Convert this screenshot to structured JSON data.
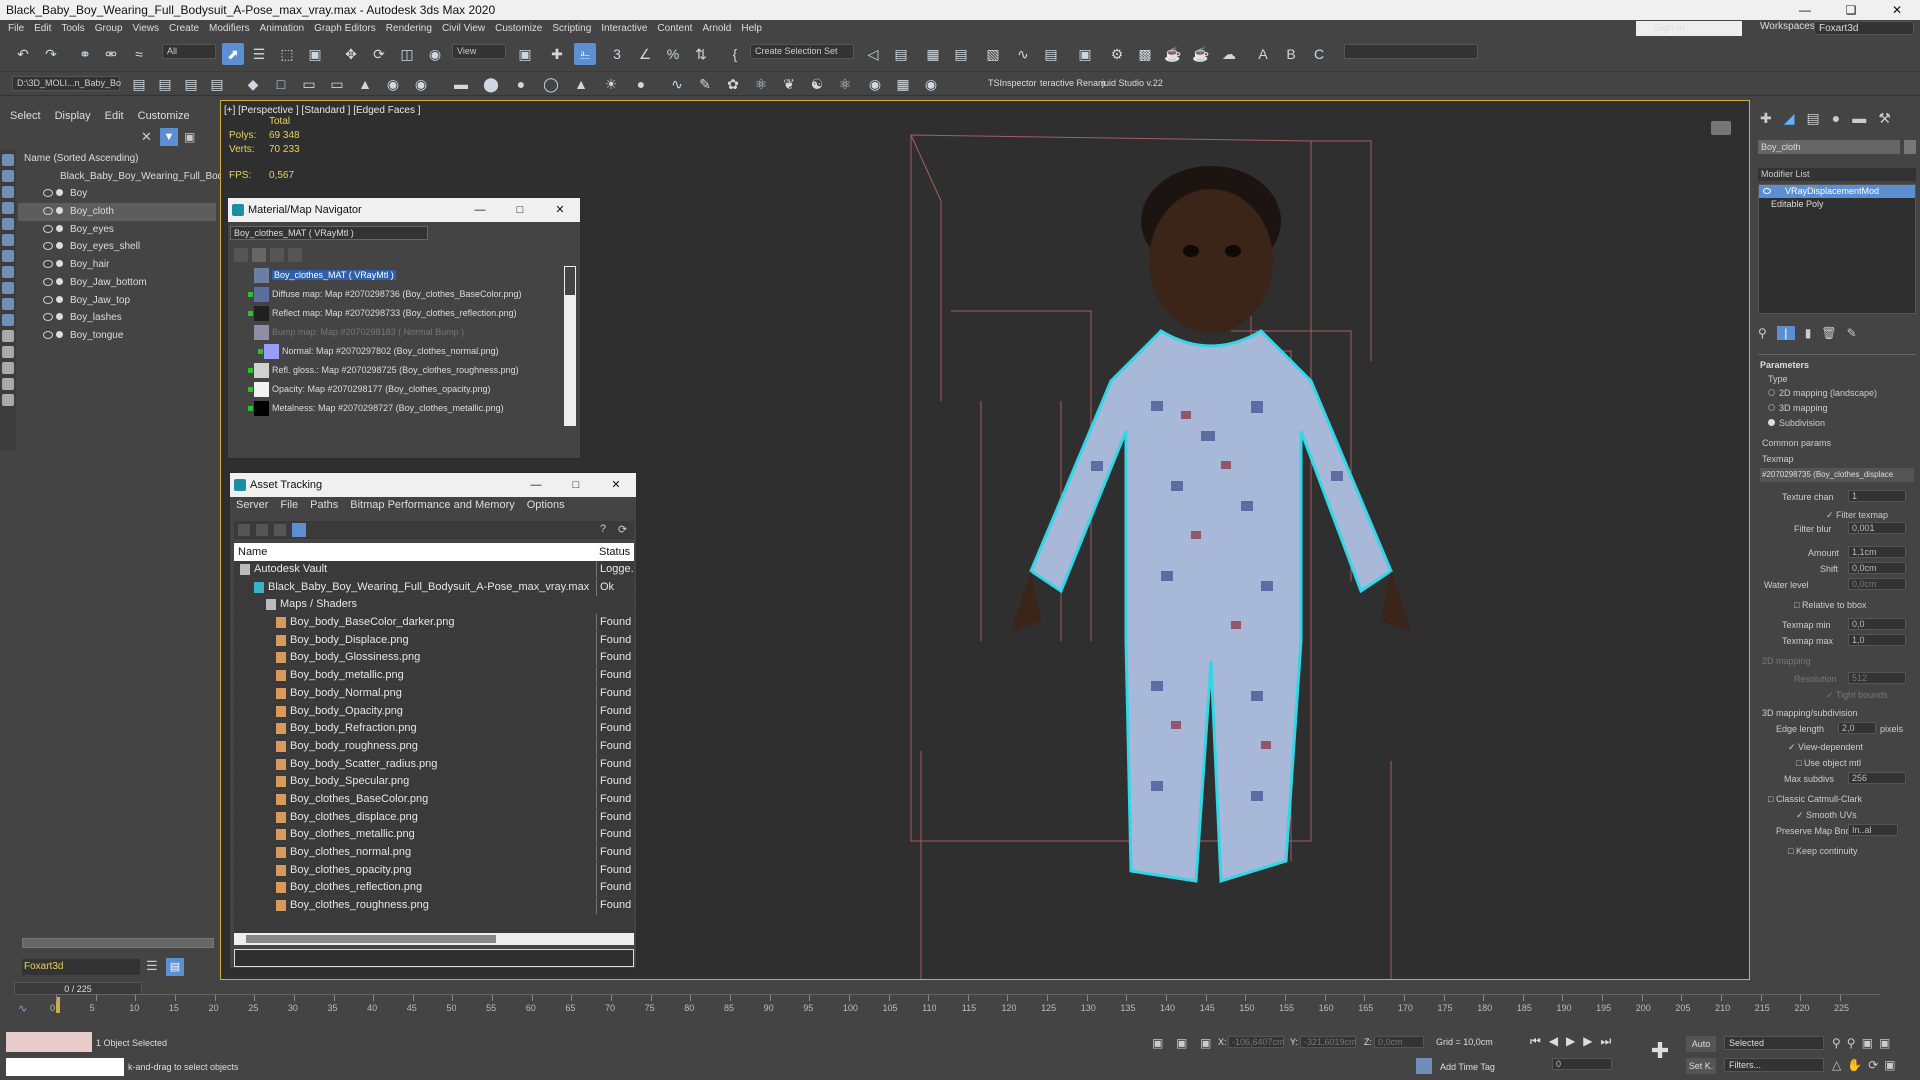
{
  "window": {
    "title": "Black_Baby_Boy_Wearing_Full_Bodysuit_A-Pose_max_vray.max - Autodesk 3ds Max 2020"
  },
  "menu": [
    "File",
    "Edit",
    "Tools",
    "Group",
    "Views",
    "Create",
    "Modifiers",
    "Animation",
    "Graph Editors",
    "Rendering",
    "Civil View",
    "Customize",
    "Scripting",
    "Interactive",
    "Content",
    "Arnold",
    "Help"
  ],
  "account": {
    "sign_in": "Sign In",
    "workspaces_label": "Workspaces:",
    "workspace": "Foxart3d"
  },
  "toolbar": {
    "filter": "All",
    "view": "View",
    "selection_set": "Create Selection Set",
    "path": "D:\\3D_MOLI...n_Baby_Bo",
    "tsinspector": "TSInspector",
    "interactive_rename": "teractive Renam",
    "fluid_studio": "juid Studio v.22"
  },
  "scene_explorer": {
    "tabs": [
      "Select",
      "Display",
      "Edit",
      "Customize"
    ],
    "sort_header": "Name (Sorted Ascending)",
    "root": "Black_Baby_Boy_Wearing_Full_Bodys",
    "items": [
      "Boy",
      "Boy_cloth",
      "Boy_eyes",
      "Boy_eyes_shell",
      "Boy_hair",
      "Boy_Jaw_bottom",
      "Boy_Jaw_top",
      "Boy_lashes",
      "Boy_tongue"
    ],
    "selected": "Boy_cloth",
    "layer": "Foxart3d"
  },
  "viewport": {
    "label": "[+] [Perspective ] [Standard ] [Edged Faces ]",
    "total_label": "Total",
    "polys_label": "Polys:",
    "polys": "69 348",
    "verts_label": "Verts:",
    "verts": "70 233",
    "fps_label": "FPS:",
    "fps": "0,567"
  },
  "material_navigator": {
    "title": "Material/Map Navigator",
    "material": "Boy_clothes_MAT  ( VRayMtl )",
    "root": "Boy_clothes_MAT  ( VRayMtl )",
    "maps": [
      {
        "label": "Diffuse map: Map #2070298736 (Boy_clothes_BaseColor.png)",
        "swatch": "#5a6f9c"
      },
      {
        "label": "Reflect map: Map #2070298733 (Boy_clothes_reflection.png)",
        "swatch": "#202020"
      },
      {
        "label": "Bump map: Map #2070298183  ( Normal Bump )",
        "swatch": "#8e8ea8"
      },
      {
        "label": "Normal: Map #2070297802 (Boy_clothes_normal.png)",
        "swatch": "#9a9cf5"
      },
      {
        "label": "Refl. gloss.: Map #2070298725 (Boy_clothes_roughness.png)",
        "swatch": "#d0d0d0"
      },
      {
        "label": "Opacity: Map #2070298177 (Boy_clothes_opacity.png)",
        "swatch": "#f2f2f2"
      },
      {
        "label": "Metalness: Map #2070298727 (Boy_clothes_metallic.png)",
        "swatch": "#000000"
      }
    ]
  },
  "asset_tracking": {
    "title": "Asset Tracking",
    "menu": [
      "Server",
      "File",
      "Paths",
      "Bitmap Performance and Memory",
      "Options"
    ],
    "columns": {
      "name": "Name",
      "status": "Status"
    },
    "rows": [
      {
        "name": "Autodesk Vault",
        "status": "Logge..."
      },
      {
        "name": "Black_Baby_Boy_Wearing_Full_Bodysuit_A-Pose_max_vray.max",
        "status": "Ok"
      },
      {
        "name": "Maps / Shaders",
        "status": ""
      },
      {
        "name": "Boy_body_BaseColor_darker.png",
        "status": "Found"
      },
      {
        "name": "Boy_body_Displace.png",
        "status": "Found"
      },
      {
        "name": "Boy_body_Glossiness.png",
        "status": "Found"
      },
      {
        "name": "Boy_body_metallic.png",
        "status": "Found"
      },
      {
        "name": "Boy_body_Normal.png",
        "status": "Found"
      },
      {
        "name": "Boy_body_Opacity.png",
        "status": "Found"
      },
      {
        "name": "Boy_body_Refraction.png",
        "status": "Found"
      },
      {
        "name": "Boy_body_roughness.png",
        "status": "Found"
      },
      {
        "name": "Boy_body_Scatter_radius.png",
        "status": "Found"
      },
      {
        "name": "Boy_body_Specular.png",
        "status": "Found"
      },
      {
        "name": "Boy_clothes_BaseColor.png",
        "status": "Found"
      },
      {
        "name": "Boy_clothes_displace.png",
        "status": "Found"
      },
      {
        "name": "Boy_clothes_metallic.png",
        "status": "Found"
      },
      {
        "name": "Boy_clothes_normal.png",
        "status": "Found"
      },
      {
        "name": "Boy_clothes_opacity.png",
        "status": "Found"
      },
      {
        "name": "Boy_clothes_reflection.png",
        "status": "Found"
      },
      {
        "name": "Boy_clothes_roughness.png",
        "status": "Found"
      }
    ]
  },
  "command_panel": {
    "object_name": "Boy_cloth",
    "modifier_list": "Modifier List",
    "stack": [
      "VRayDisplacementMod",
      "Editable Poly"
    ],
    "rollout": "Parameters",
    "type_label": "Type",
    "types": [
      "2D mapping (landscape)",
      "3D mapping",
      "Subdivision"
    ],
    "common_params": "Common params",
    "texmap_label": "Texmap",
    "texmap": "#2070298735 (Boy_clothes_displace",
    "texture_chan_label": "Texture chan",
    "texture_chan": "1",
    "filter_texmap": "Filter texmap",
    "filter_blur_label": "Filter blur",
    "filter_blur": "0,001",
    "amount_label": "Amount",
    "amount": "1,1cm",
    "shift_label": "Shift",
    "shift": "0,0cm",
    "water_level_label": "Water level",
    "water_level": "0,0cm",
    "relative_to_bbox": "Relative to bbox",
    "texmap_min_label": "Texmap min",
    "texmap_min": "0,0",
    "texmap_max_label": "Texmap max",
    "texmap_max": "1,0",
    "mapping_2d": "2D mapping",
    "resolution_label": "Resolution",
    "resolution": "512",
    "tight_bounds": "Tight bounds",
    "mapping_3d": "3D mapping/subdivision",
    "edge_length_label": "Edge length",
    "edge_length": "2,0",
    "pixels": "pixels",
    "view_dependent": "View-dependent",
    "use_object_mtl": "Use object mtl",
    "max_subdivs_label": "Max subdivs",
    "max_subdivs": "256",
    "classic_catmull": "Classic Catmull-Clark",
    "smooth_uvs": "Smooth UVs",
    "preserve_map_label": "Preserve Map Bnd",
    "preserve_map": "In..al",
    "keep_continuity": "Keep continuity"
  },
  "timeline": {
    "frame": "0 / 225",
    "ticks": [
      "0",
      "5",
      "10",
      "15",
      "20",
      "25",
      "30",
      "35",
      "40",
      "45",
      "50",
      "55",
      "60",
      "65",
      "70",
      "75",
      "80",
      "85",
      "90",
      "95",
      "100",
      "105",
      "110",
      "115",
      "120",
      "125",
      "130",
      "135",
      "140",
      "145",
      "150",
      "155",
      "160",
      "165",
      "170",
      "175",
      "180",
      "185",
      "190",
      "195",
      "200",
      "205",
      "210",
      "215",
      "220",
      "225"
    ]
  },
  "status": {
    "objects_selected": "1 Object Selected",
    "prompt": "k-and-drag to select objects",
    "x_label": "X:",
    "x": "-106,6407cm",
    "y_label": "Y:",
    "y": "-321,6019cm",
    "z_label": "Z:",
    "z": "0,0cm",
    "grid": "Grid = 10,0cm",
    "add_time_tag": "Add Time Tag",
    "auto": "Auto",
    "set_key": "Set K.",
    "selected": "Selected",
    "filters": "Filters...",
    "frame_value": "0"
  },
  "colors": {
    "accent": "#5b8fd1",
    "selection_outline": "#33d6e6",
    "viewport_border": "#c9b043",
    "stats_yellow": "#e5d35a"
  }
}
